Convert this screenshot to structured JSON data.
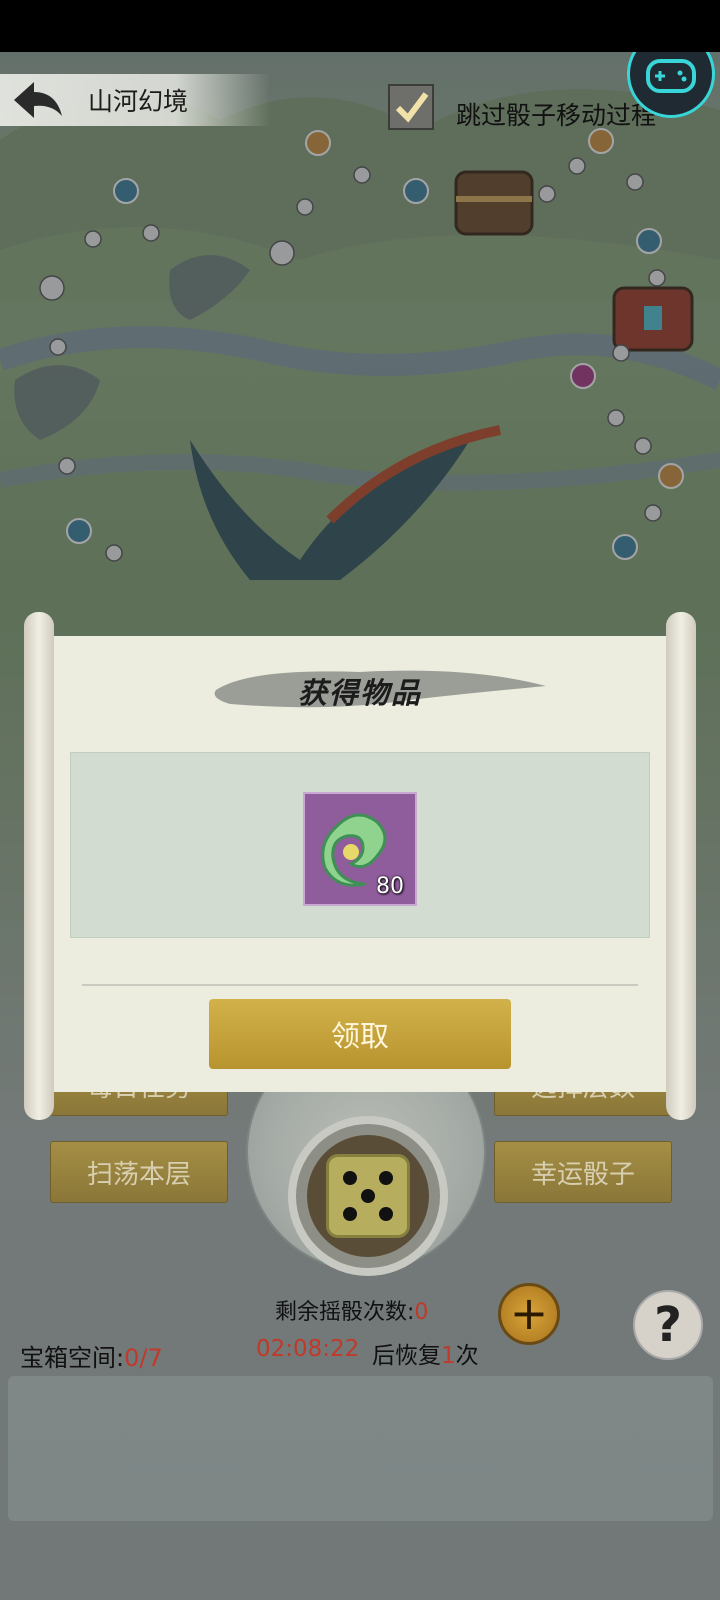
{
  "header": {
    "title": "山河幻境",
    "skip_label": "跳过骰子移动过程",
    "skip_checked": true
  },
  "menu": {
    "daily_tasks": "每日任务",
    "select_floor": "选择层数",
    "sweep_floor": "扫荡本层",
    "lucky_dice": "幸运骰子"
  },
  "dice": {
    "face": 5
  },
  "status": {
    "rolls_label": "剩余摇骰次数:",
    "rolls_value": "0",
    "chest_label": "宝箱空间:",
    "chest_value": "0/7",
    "timer": "02:08:22",
    "recover_prefix": "后恢复",
    "recover_count": "1",
    "recover_suffix": "次"
  },
  "dialog": {
    "title": "获得物品",
    "item": {
      "icon": "jade-dragon-icon",
      "count": "80"
    },
    "claim_label": "领取"
  },
  "colors": {
    "gold_button": "#b8942f",
    "menu_button": "#8a7638",
    "highlight_red": "#c0392b",
    "gamepad_ring": "#38d6d8"
  }
}
